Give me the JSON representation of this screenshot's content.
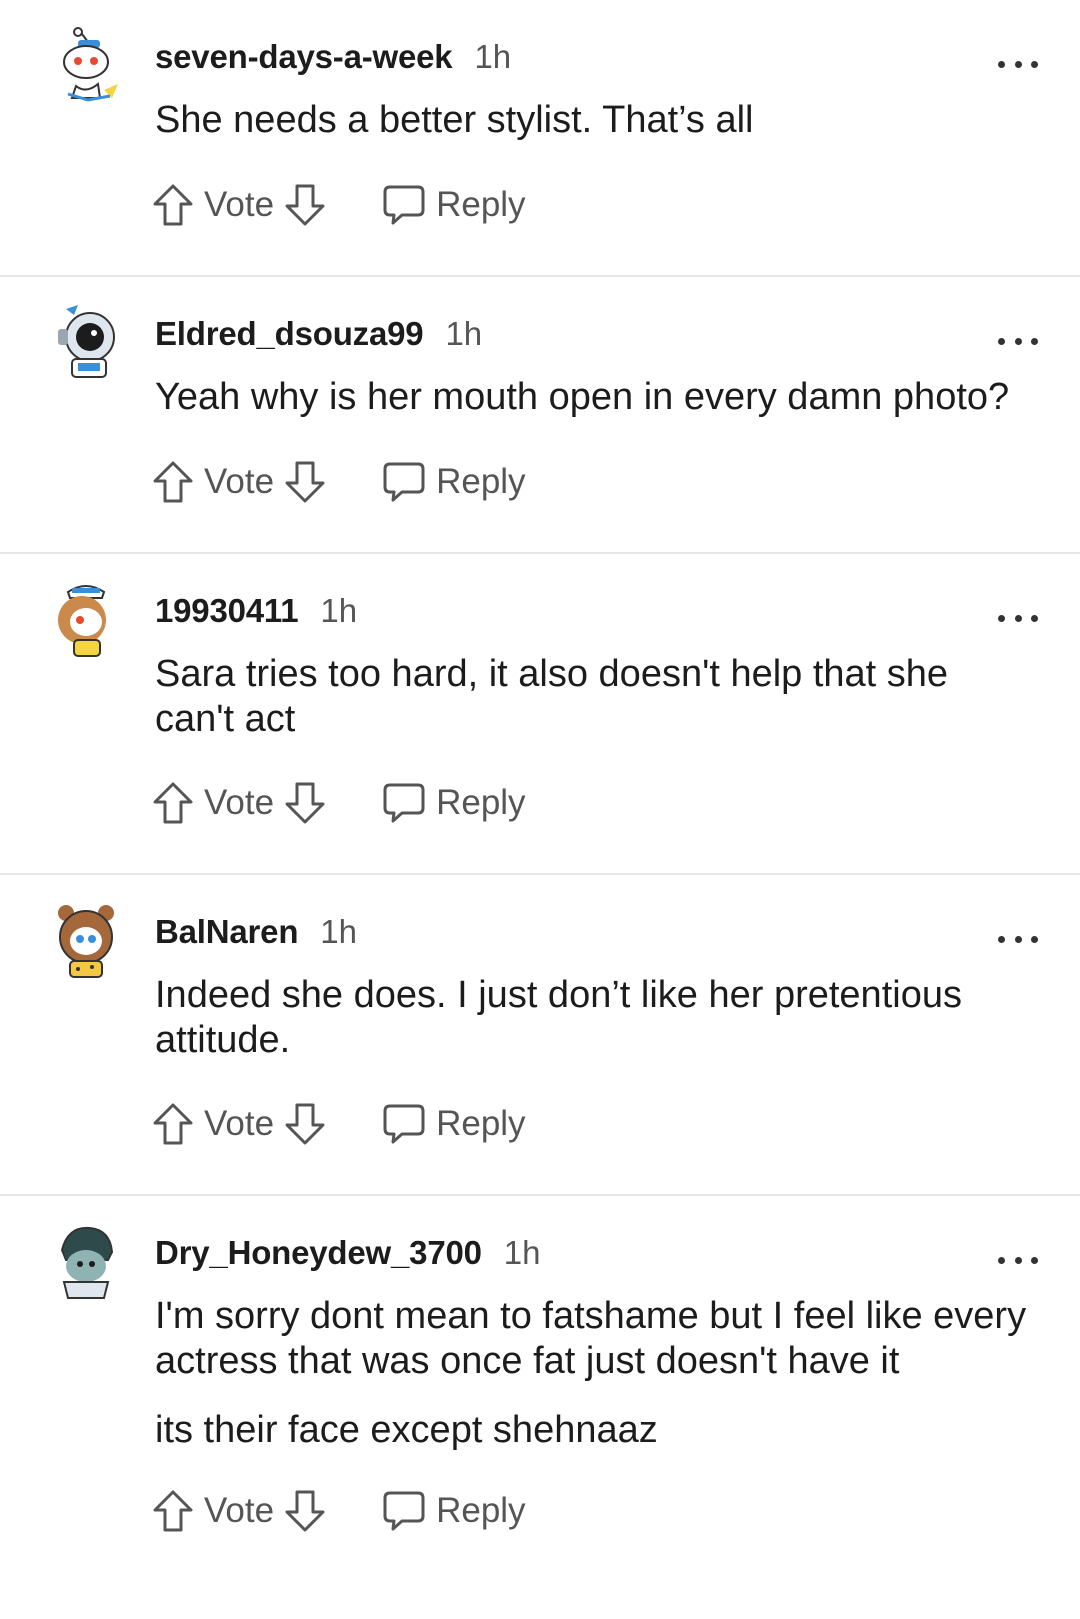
{
  "comments": [
    {
      "username": "seven-days-a-week",
      "time": "1h",
      "avatar_icon": "robot-snoo-avatar-icon",
      "text": [
        "She needs a better stylist. That’s all"
      ],
      "vote_label": "Vote",
      "reply_label": "Reply"
    },
    {
      "username": "Eldred_dsouza99",
      "time": "1h",
      "avatar_icon": "astronaut-snoo-avatar-icon",
      "text": [
        "Yeah why is her mouth open in every damn photo?"
      ],
      "vote_label": "Vote",
      "reply_label": "Reply"
    },
    {
      "username": "19930411",
      "time": "1h",
      "avatar_icon": "sailor-snoo-avatar-icon",
      "text": [
        "Sara tries too hard, it also doesn't help that she can't act"
      ],
      "vote_label": "Vote",
      "reply_label": "Reply"
    },
    {
      "username": "BalNaren",
      "time": "1h",
      "avatar_icon": "bear-hood-snoo-avatar-icon",
      "text": [
        "Indeed she does. I just don’t like her pretentious attitude."
      ],
      "vote_label": "Vote",
      "reply_label": "Reply"
    },
    {
      "username": "Dry_Honeydew_3700",
      "time": "1h",
      "avatar_icon": "hooded-snoo-avatar-icon",
      "text": [
        "I'm sorry dont mean to fatshame but I feel like every actress that was once fat just doesn't have it",
        "its their face except shehnaaz"
      ],
      "vote_label": "Vote",
      "reply_label": "Reply"
    }
  ],
  "colors": {
    "text": "#1c1c1c",
    "meta": "#555555",
    "divider": "#e6e6e6"
  }
}
